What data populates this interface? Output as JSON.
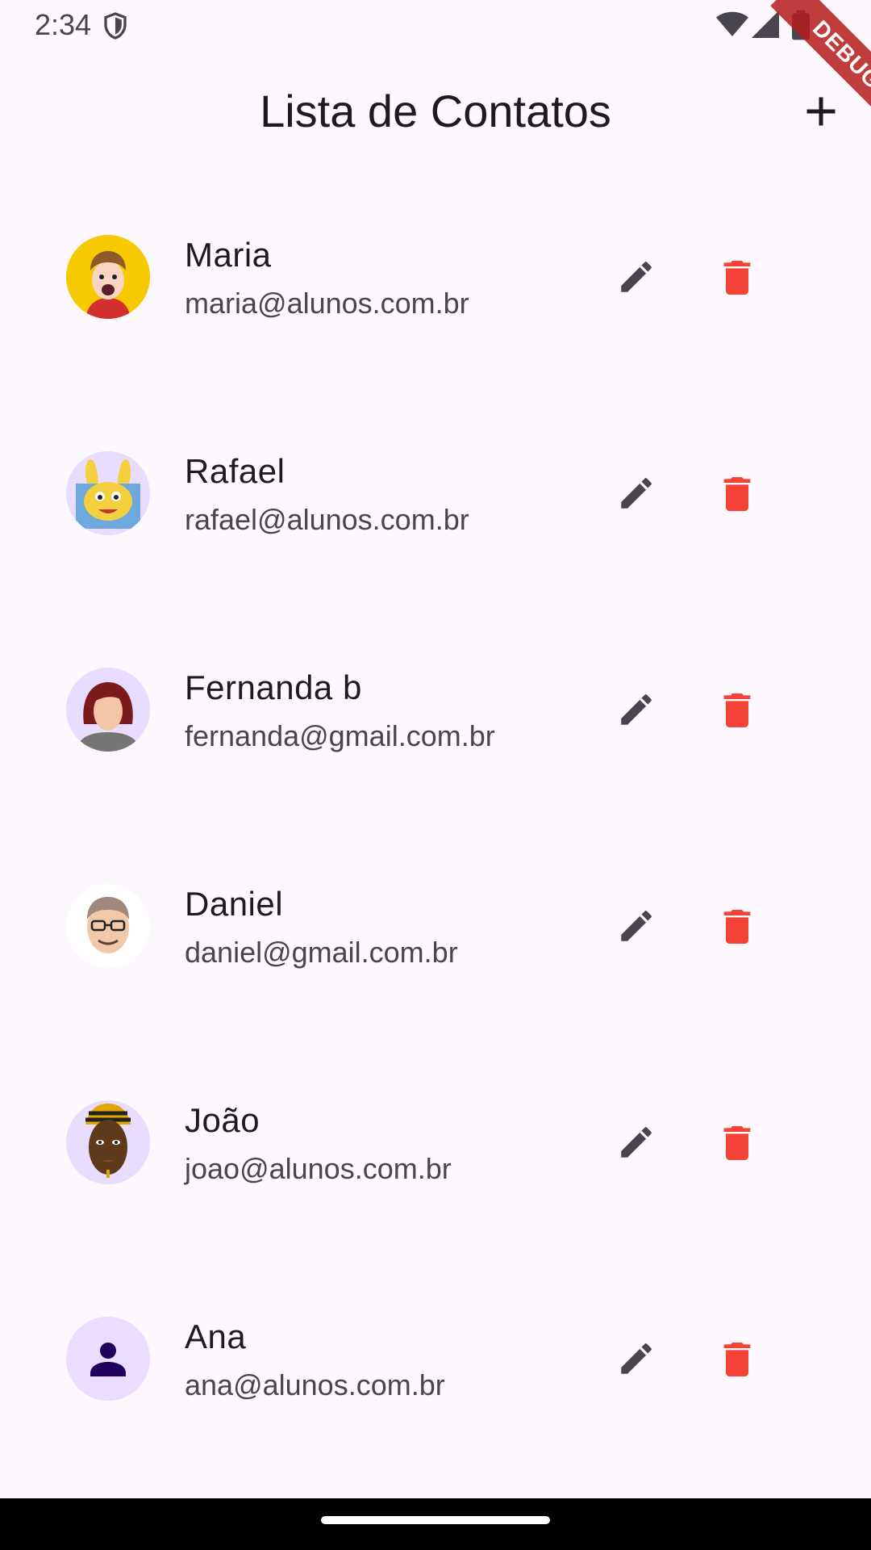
{
  "status": {
    "time": "2:34"
  },
  "appbar": {
    "title": "Lista de Contatos"
  },
  "debug_banner": "DEBUG",
  "colors": {
    "background": "#fdf7fe",
    "delete": "#f44336",
    "edit": "#49454f"
  },
  "contacts": [
    {
      "name": "Maria",
      "email": "maria@alunos.com.br",
      "avatar": "cartoon-boy-avatar"
    },
    {
      "name": "Rafael",
      "email": "rafael@alunos.com.br",
      "avatar": "cartoon-rabbit-avatar"
    },
    {
      "name": "Fernanda b",
      "email": "fernanda@gmail.com.br",
      "avatar": "red-hair-woman-avatar"
    },
    {
      "name": "Daniel",
      "email": "daniel@gmail.com.br",
      "avatar": "glasses-man-avatar"
    },
    {
      "name": "João",
      "email": "joao@alunos.com.br",
      "avatar": "headwrap-woman-avatar"
    },
    {
      "name": "Ana",
      "email": "ana@alunos.com.br",
      "avatar": "person-icon"
    }
  ]
}
